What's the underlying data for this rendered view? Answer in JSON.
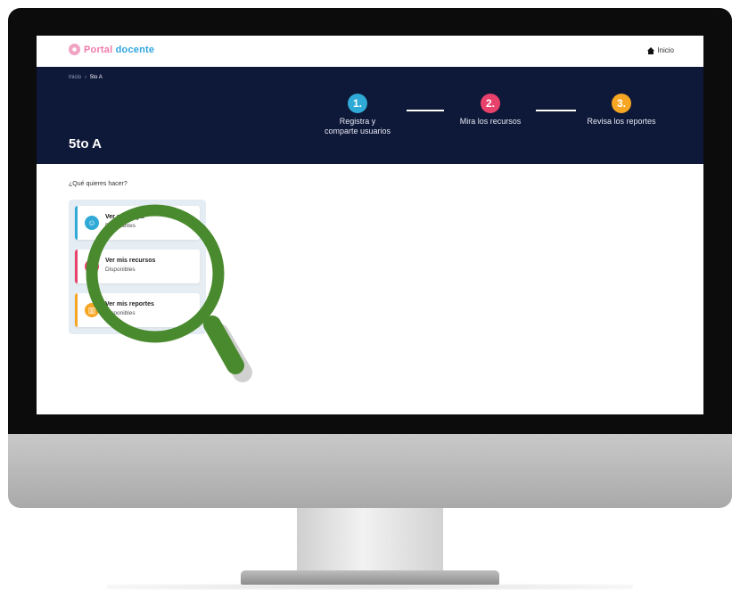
{
  "app": {
    "logo_part1": "Portal",
    "logo_part2": "docente",
    "home_link": "Inicio"
  },
  "breadcrumb": {
    "items": [
      "Inicio",
      "5to A"
    ]
  },
  "page_title": "5to A",
  "steps": [
    {
      "number": "1.",
      "label_line1": "Registra y",
      "label_line2": "comparte usuarios",
      "color": "#2fa9d6"
    },
    {
      "number": "2.",
      "label_line1": "Mira los recursos",
      "label_line2": "",
      "color": "#e8416b"
    },
    {
      "number": "3.",
      "label_line1": "Revisa los reportes",
      "label_line2": "",
      "color": "#f6a623"
    }
  ],
  "question": "¿Qué quieres hacer?",
  "options": [
    {
      "title": "Ver o agregar",
      "subtitle": "Estudiantes",
      "color": "#2fa9d6",
      "icon": "users-icon"
    },
    {
      "title": "Ver mis recursos",
      "subtitle": "Disponibles",
      "color": "#e8416b",
      "icon": "book-icon"
    },
    {
      "title": "Ver mis reportes",
      "subtitle": "Disponibles",
      "color": "#f6a623",
      "icon": "chart-icon"
    }
  ],
  "colors": {
    "hero_background": "#0e1838",
    "magnifier": "#4a8a2e",
    "panel_background": "#e5edf4"
  }
}
